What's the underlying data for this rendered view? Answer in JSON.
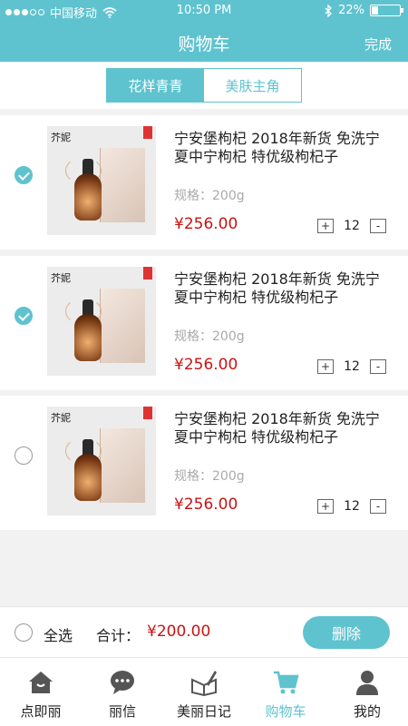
{
  "status_bar": {
    "carrier": "中国移动",
    "time": "10:50 PM",
    "battery": "22%",
    "battery_level": 0.22
  },
  "nav": {
    "title": "购物车",
    "done_label": "完成"
  },
  "segments": [
    {
      "label": "花样青青",
      "active": true
    },
    {
      "label": "美肤主角",
      "active": false
    }
  ],
  "items": [
    {
      "title": "宁安堡枸杞 2018年新货 免洗宁夏中宁枸杞 特优级枸杞子",
      "spec": "规格：200g",
      "price": "¥256.00",
      "qty": "12",
      "checked": true,
      "brand": "芥妮"
    },
    {
      "title": "宁安堡枸杞 2018年新货 免洗宁夏中宁枸杞 特优级枸杞子",
      "spec": "规格：200g",
      "price": "¥256.00",
      "qty": "12",
      "checked": true,
      "brand": "芥妮"
    },
    {
      "title": "宁安堡枸杞 2018年新货 免洗宁夏中宁枸杞 特优级枸杞子",
      "spec": "规格：200g",
      "price": "¥256.00",
      "qty": "12",
      "checked": false,
      "brand": "芥妮"
    }
  ],
  "stepper": {
    "plus": "+",
    "minus": "-"
  },
  "footer": {
    "select_all": "全选",
    "total_label": "合计：",
    "total_value": "¥200.00",
    "delete_label": "删除"
  },
  "tabbar": [
    {
      "label": "点即丽",
      "icon": "home-icon",
      "active": false
    },
    {
      "label": "丽信",
      "icon": "chat-icon",
      "active": false
    },
    {
      "label": "美丽日记",
      "icon": "diary-icon",
      "active": false
    },
    {
      "label": "购物车",
      "icon": "cart-icon",
      "active": true
    },
    {
      "label": "我的",
      "icon": "user-icon",
      "active": false
    }
  ],
  "colors": {
    "accent": "#5ec3cf",
    "price": "#c81414"
  }
}
